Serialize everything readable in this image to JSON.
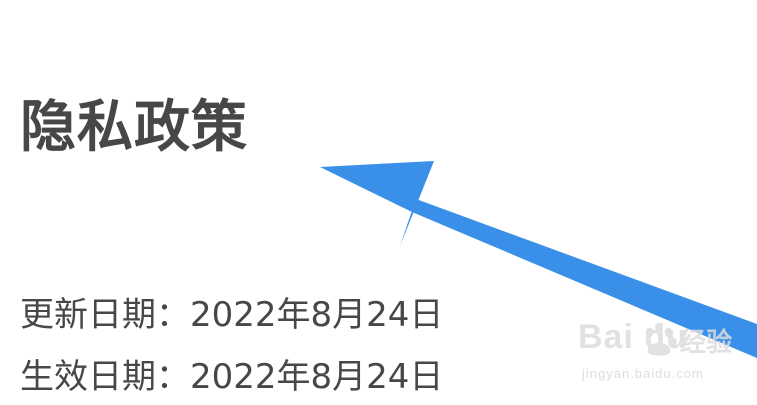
{
  "page": {
    "title": "隐私政策",
    "updated": "更新日期：2022年8月24日",
    "effective": "生效日期：2022年8月24日"
  },
  "watermark": {
    "logo": "Bai du",
    "brand": "经验",
    "url": "jingyan.baidu.com"
  },
  "colors": {
    "text": "#474747",
    "arrow": "#3a8fe8",
    "background": "#ffffff",
    "watermark": "#dcdcdc"
  },
  "icons": {
    "arrow": "arrow-annotation-icon",
    "paw": "baidu-paw-icon"
  }
}
